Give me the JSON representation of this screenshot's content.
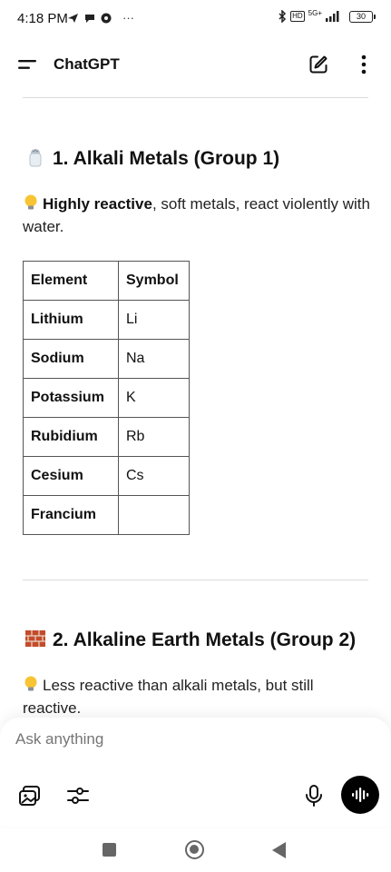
{
  "status_bar": {
    "time": "4:18 PM",
    "dots": "···",
    "network": "5G+",
    "hd": "HD",
    "battery": "30"
  },
  "header": {
    "title": "ChatGPT"
  },
  "section1": {
    "title": "1. Alkali Metals (Group 1)",
    "emoji": "salt-shaker",
    "desc_bold": "Highly reactive",
    "desc_rest": ", soft metals, react violently with water."
  },
  "table": {
    "headers": [
      "Element",
      "Symbol"
    ],
    "rows": [
      [
        "Lithium",
        "Li"
      ],
      [
        "Sodium",
        "Na"
      ],
      [
        "Potassium",
        "K"
      ],
      [
        "Rubidium",
        "Rb"
      ],
      [
        "Cesium",
        "Cs"
      ],
      [
        "Francium",
        ""
      ]
    ]
  },
  "section2": {
    "title": "2. Alkaline Earth Metals (Group 2)",
    "emoji": "brick",
    "desc": "Less reactive than alkali metals, but still reactive."
  },
  "composer": {
    "placeholder": "Ask anything"
  },
  "colors": {
    "voice_button": "#000000",
    "divider": "#dcdcdc",
    "nav_icons": "#666666"
  }
}
